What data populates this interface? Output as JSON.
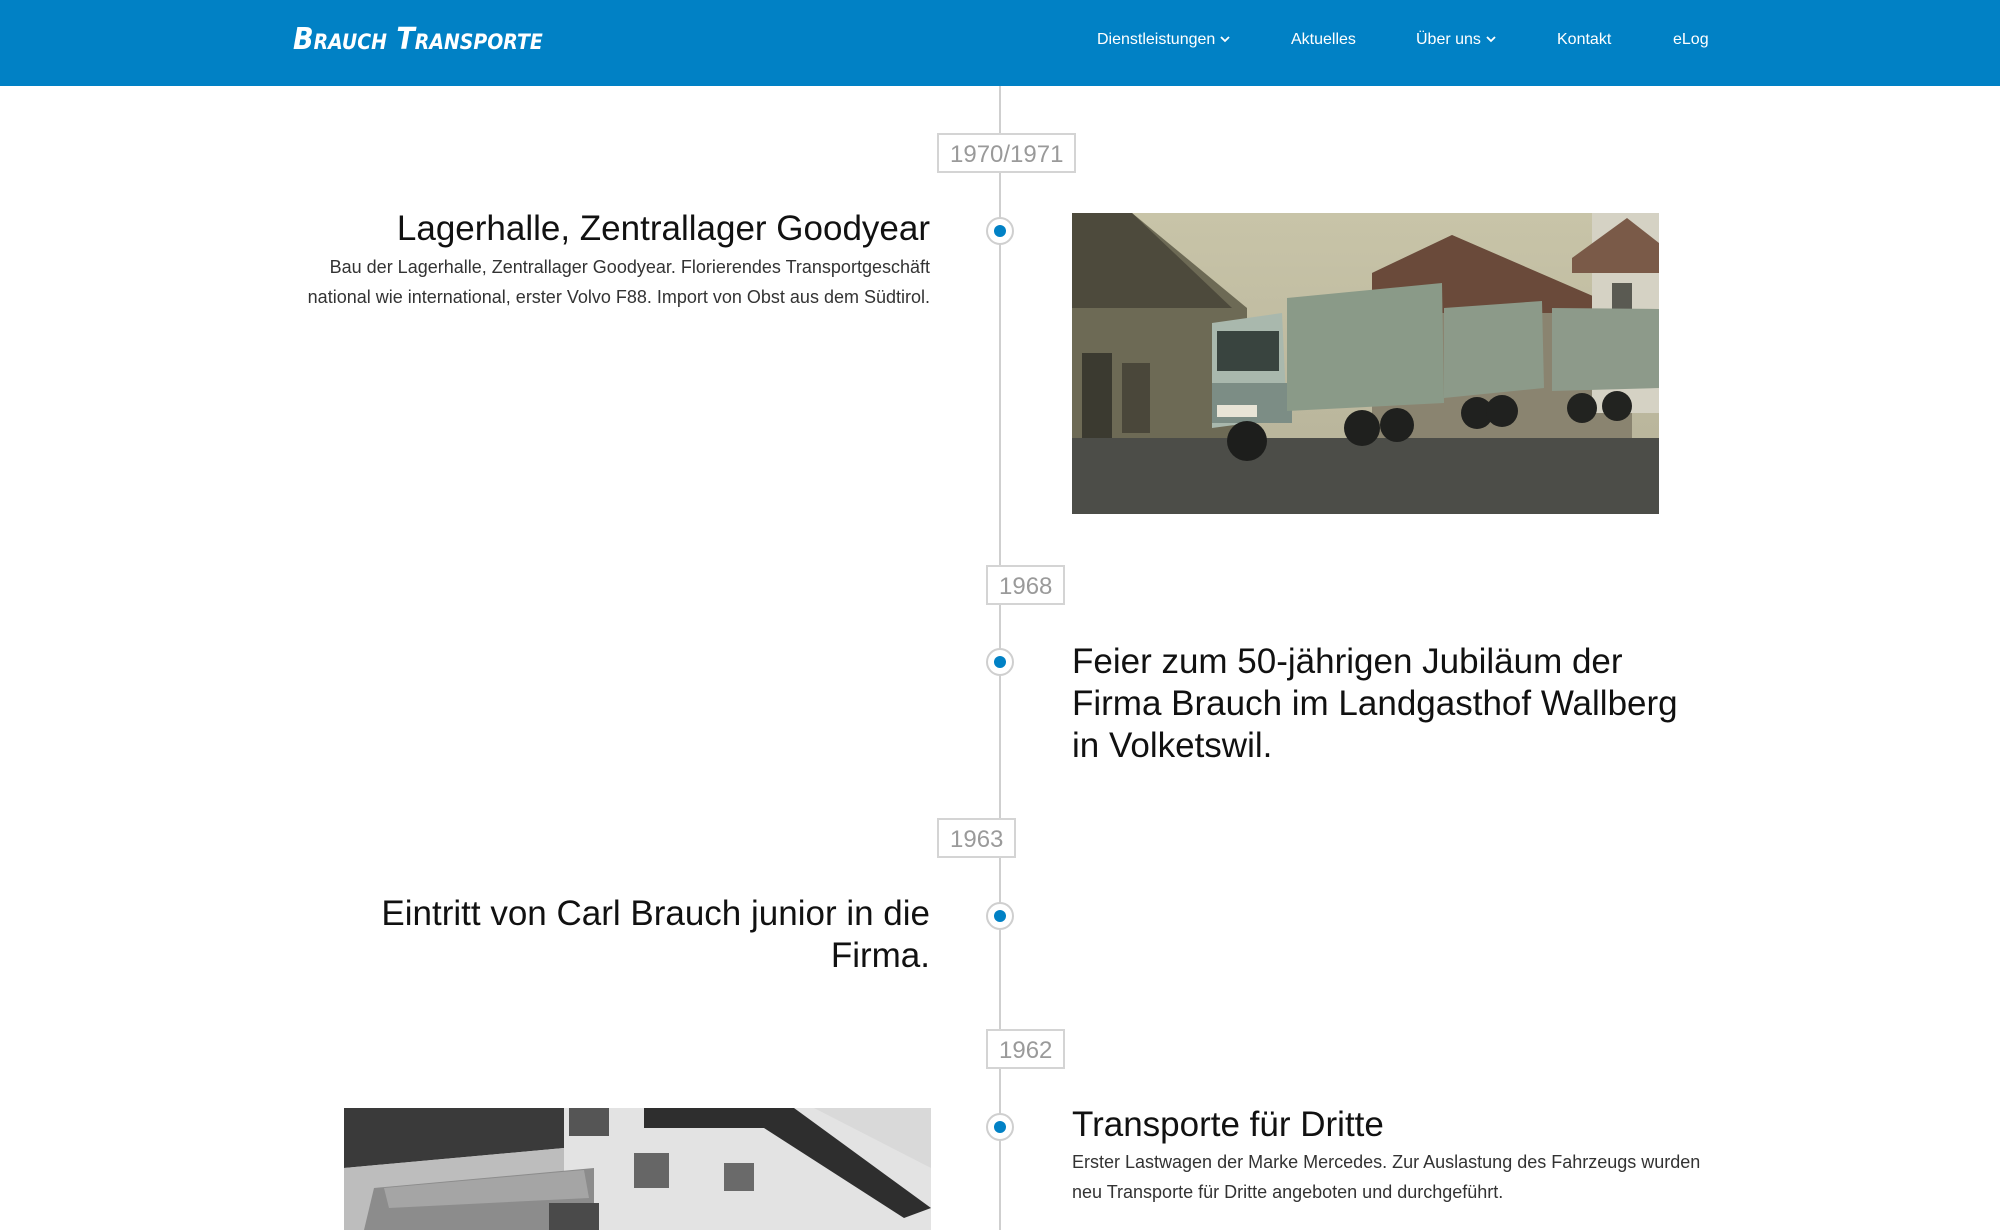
{
  "header": {
    "logo": "Brauch Transporte",
    "nav": [
      {
        "label": "Dienstleistungen",
        "has_dropdown": true
      },
      {
        "label": "Aktuelles",
        "has_dropdown": false
      },
      {
        "label": "Über uns",
        "has_dropdown": true
      },
      {
        "label": "Kontakt",
        "has_dropdown": false
      },
      {
        "label": "eLog",
        "has_dropdown": false
      }
    ]
  },
  "timeline": [
    {
      "year": "1970/1971",
      "title": "Lagerhalle, Zentrallager Goodyear",
      "text": "Bau der Lagerhalle, Zentrallager Goodyear. Florierendes Transportgeschäft national wie international, erster Volvo F88. Import von Obst aus dem Südtirol.",
      "image": "truck-photo-color"
    },
    {
      "year": "1968",
      "title": "Feier zum 50-jährigen Jubiläum der Firma Brauch im Landgasthof Wallberg in Volketswil."
    },
    {
      "year": "1963",
      "title": "Eintritt von Carl Brauch junior in die Firma."
    },
    {
      "year": "1962",
      "title": "Transporte für Dritte",
      "text": "Erster Lastwagen der Marke Mercedes. Zur Auslastung des Fahrzeugs wurden neu Transporte für Dritte angeboten und durchgeführt.",
      "image": "truck-photo-bw"
    }
  ],
  "colors": {
    "brand": "#0181c5",
    "line": "#cfcfcf",
    "year_text": "#9a9a9a"
  }
}
